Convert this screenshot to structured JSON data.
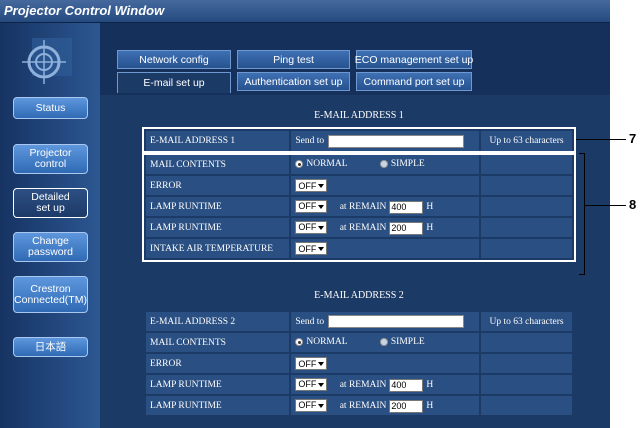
{
  "window": {
    "title": "Projector Control Window"
  },
  "sidebar": {
    "items": [
      {
        "label": "Status"
      },
      {
        "label": "Projector\ncontrol"
      },
      {
        "label": "Detailed\nset up"
      },
      {
        "label": "Change\npassword"
      },
      {
        "label": "Crestron\nConnected(TM)"
      },
      {
        "label": "日本語"
      }
    ]
  },
  "tabs": {
    "row1": [
      "Network config",
      "Ping test",
      "ECO management set up"
    ],
    "row2": [
      "E-mail set up",
      "Authentication set up",
      "Command port set up"
    ]
  },
  "section1": {
    "title": "E-MAIL ADDRESS 1",
    "address_label": "E-MAIL ADDRESS 1",
    "send_to": "Send to",
    "address_value": "",
    "limit": "Up to 63 characters",
    "mail_contents": "MAIL CONTENTS",
    "normal": "NORMAL",
    "simple": "SIMPLE",
    "error": "ERROR",
    "error_value": "OFF",
    "lamp1": "LAMP RUNTIME",
    "lamp1_value": "OFF",
    "lamp1_remain_label": "at REMAIN",
    "lamp1_remain": "400",
    "lamp1_unit": "H",
    "lamp2": "LAMP RUNTIME",
    "lamp2_value": "OFF",
    "lamp2_remain_label": "at REMAIN",
    "lamp2_remain": "200",
    "lamp2_unit": "H",
    "intake": "INTAKE AIR TEMPERATURE",
    "intake_value": "OFF"
  },
  "section2": {
    "title": "E-MAIL ADDRESS 2",
    "address_label": "E-MAIL ADDRESS 2",
    "send_to": "Send to",
    "address_value": "",
    "limit": "Up to 63 characters",
    "mail_contents": "MAIL CONTENTS",
    "normal": "NORMAL",
    "simple": "SIMPLE",
    "error": "ERROR",
    "error_value": "OFF",
    "lamp1": "LAMP RUNTIME",
    "lamp1_value": "OFF",
    "lamp1_remain_label": "at REMAIN",
    "lamp1_remain": "400",
    "lamp1_unit": "H",
    "lamp2": "LAMP RUNTIME",
    "lamp2_value": "OFF",
    "lamp2_remain_label": "at REMAIN",
    "lamp2_remain": "200",
    "lamp2_unit": "H"
  },
  "callouts": {
    "c7": "7",
    "c8": "8"
  }
}
